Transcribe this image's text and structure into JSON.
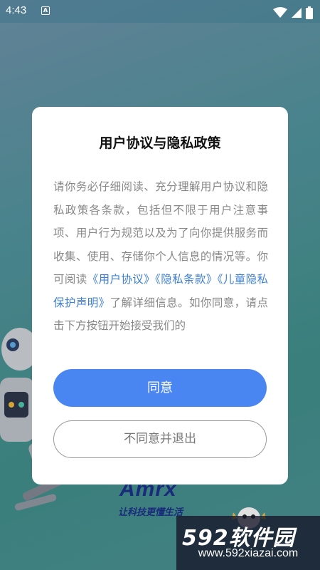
{
  "status_bar": {
    "time": "4:43",
    "notification_badge": "A"
  },
  "background": {
    "brand_logo": "Amrx",
    "slogan": "让科技更懂生活"
  },
  "watermark": {
    "title": "592软件园",
    "url": "www.592xiazai.com"
  },
  "dialog": {
    "title": "用户协议与隐私政策",
    "body": {
      "intro": "请你务必仔细阅读、充分理解用户协议和隐私政策各条款，包括但不限于用户注意事项、用户行为规范以及为了向你提供服务而收集、使用、存储你个人信息的情况等。你可阅读",
      "link_user_agreement": "《用户协议》",
      "link_privacy_terms": "《隐私条款》",
      "link_child_privacy": "《儿童隐私保护声明》",
      "outro": "了解详细信息。如你同意，请点击下方按钮开始接受我们的"
    },
    "agree_label": "同意",
    "disagree_label": "不同意并退出"
  },
  "colors": {
    "primary": "#4a86f2",
    "link": "#3d7fd8",
    "body_text": "#888888"
  }
}
